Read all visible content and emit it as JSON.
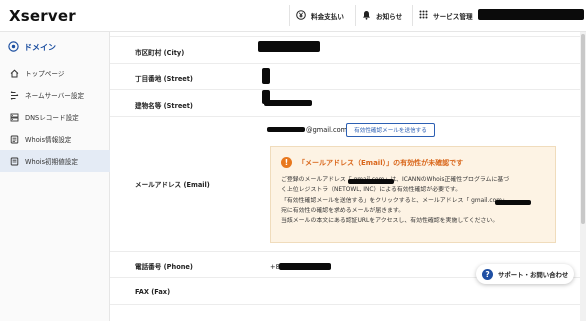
{
  "app": {
    "logo": "Xserver"
  },
  "topnav": {
    "billing": "料金支払い",
    "notice": "お知らせ",
    "service": "サービス管理"
  },
  "sidebar": {
    "title": "ドメイン",
    "items": [
      {
        "label": "トップページ",
        "icon": "home-icon",
        "active": false
      },
      {
        "label": "ネームサーバー設定",
        "icon": "nameserver-icon",
        "active": false
      },
      {
        "label": "DNSレコード設定",
        "icon": "dns-icon",
        "active": false
      },
      {
        "label": "Whois情報設定",
        "icon": "whois-icon",
        "active": false
      },
      {
        "label": "Whois初期値設定",
        "icon": "whois-default-icon",
        "active": true
      }
    ]
  },
  "form": {
    "city_label": "市区町村 (City)",
    "street1_label": "丁目番地 (Street)",
    "street2_label": "建物名等 (Street)",
    "email_label": "メールアドレス (Email)",
    "email_value": "@gmail.com",
    "send_button": "有効性確認メールを送信する",
    "phone_label": "電話番号 (Phone)",
    "phone_value": "+8",
    "fax_label": "FAX (Fax)"
  },
  "alert": {
    "title": "「メールアドレス（Email）」の有効性が未確認です",
    "lines": [
      "ご登録のメールアドレス「                    gmail.com」は、ICANNのWhois正確性プログラムに基づ",
      "く上位レジストラ（NETOWL, INC）による有効性確認が必要です。",
      "「有効性確認メールを送信する」をクリックすると、メールアドレス「                  gmail.com」",
      "宛に有効性の確認を求めるメールが届きます。",
      "当該メールの本文にある認証URLをアクセスし、有効性確認を実施してください。"
    ]
  },
  "support": {
    "label": "サポート・お問い合わせ"
  },
  "colors": {
    "brand_blue": "#1b4ea0",
    "alert_orange": "#e8781e",
    "alert_bg": "#fdf3e4"
  }
}
